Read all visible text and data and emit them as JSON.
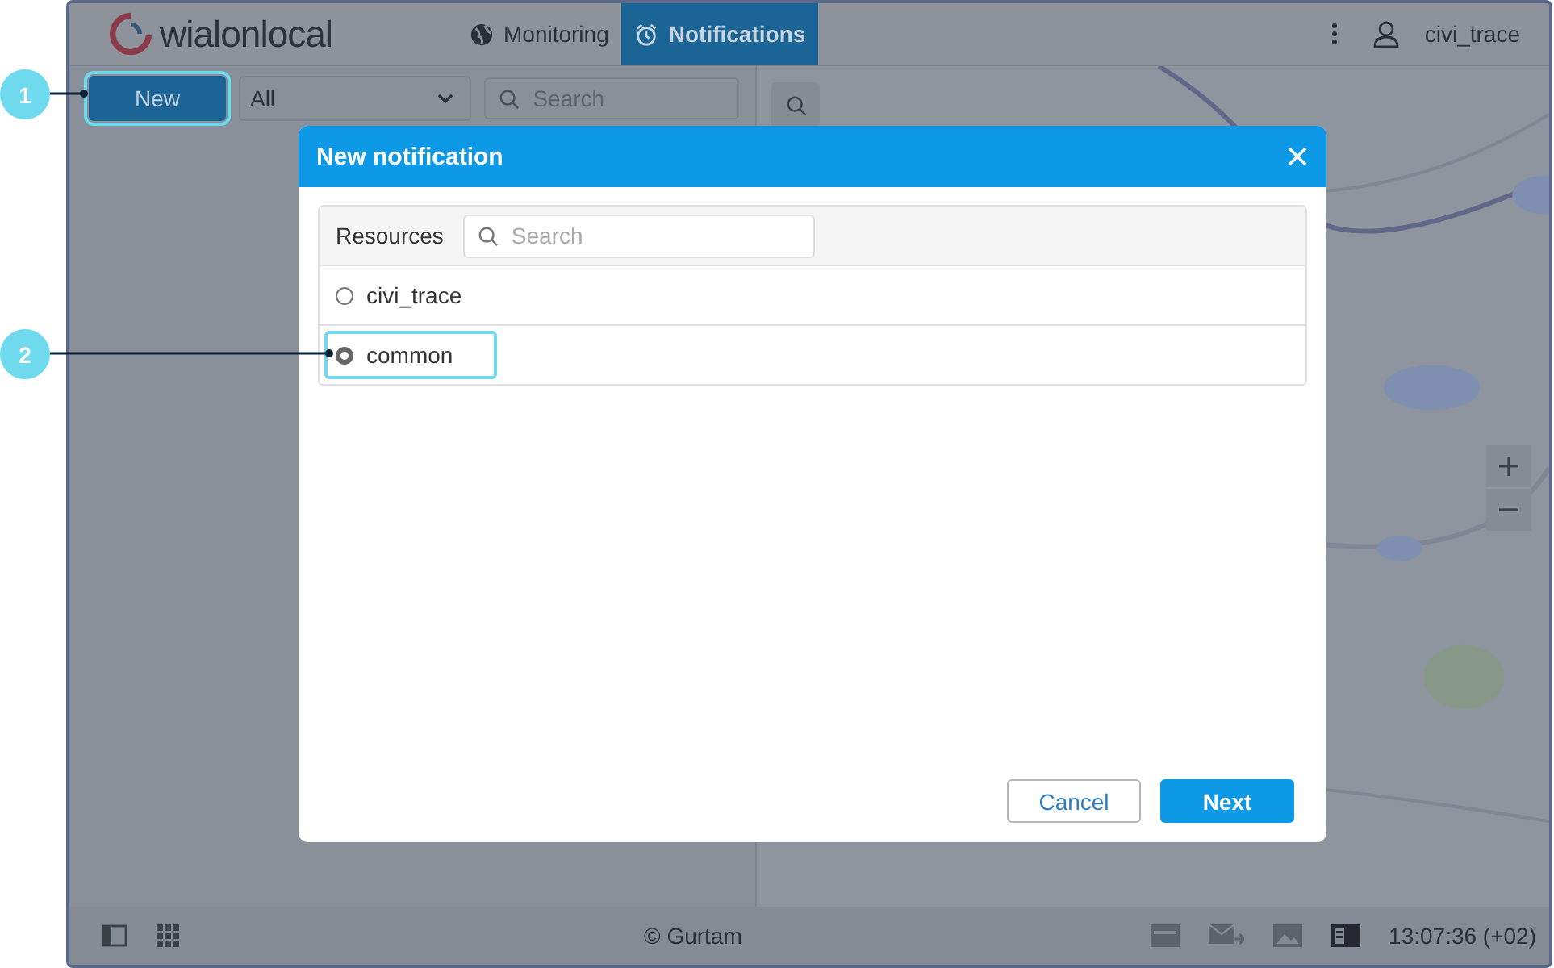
{
  "header": {
    "logo": "wialonlocal",
    "tabs": [
      {
        "label": "Monitoring",
        "selected": false
      },
      {
        "label": "Notifications",
        "selected": true
      }
    ],
    "user": "civi_trace"
  },
  "toolbar": {
    "new_button": "New",
    "filter": "All",
    "search": {
      "placeholder": "Search"
    }
  },
  "dialog": {
    "title": "New notification",
    "resources_label": "Resources",
    "search": {
      "placeholder": "Search"
    },
    "resources": [
      {
        "name": "civi_trace",
        "selected": false
      },
      {
        "name": "common",
        "selected": true
      }
    ],
    "buttons": {
      "cancel": "Cancel",
      "next": "Next"
    }
  },
  "callouts": [
    {
      "number": "1"
    },
    {
      "number": "2"
    }
  ],
  "footer": {
    "copyright": "© Gurtam",
    "time": "13:07:36 (+02)"
  }
}
